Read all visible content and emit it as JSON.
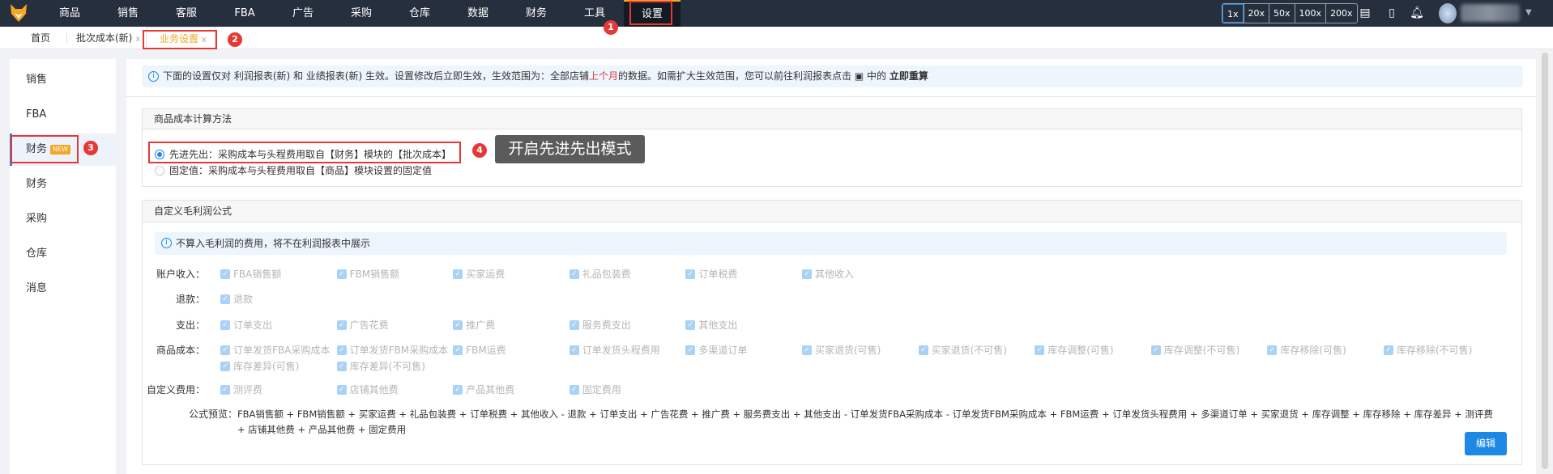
{
  "nav": {
    "items": [
      "商品",
      "销售",
      "客服",
      "FBA",
      "广告",
      "采购",
      "仓库",
      "数据",
      "财务",
      "工具",
      "设置"
    ],
    "active": "设置",
    "zoom_options": [
      "1x",
      "20x",
      "50x",
      "100x",
      "200x"
    ]
  },
  "tabs": {
    "home": "首页",
    "batch_cost": "批次成本(新)",
    "business_settings": "业务设置",
    "close": "x"
  },
  "annotations": {
    "b1": "1",
    "b2": "2",
    "b3": "3",
    "b4": "4",
    "tooltip": "开启先进先出模式"
  },
  "sidebar": {
    "items": [
      {
        "label": "销售"
      },
      {
        "label": "FBA"
      },
      {
        "label": "财务",
        "badge": "NEW"
      },
      {
        "label": "财务"
      },
      {
        "label": "采购"
      },
      {
        "label": "仓库"
      },
      {
        "label": "消息"
      }
    ]
  },
  "notice": {
    "pre": "下面的设置仅对 利润报表(新) 和 业绩报表(新) 生效。设置修改后立即生效，生效范围为：全部店铺",
    "highlight": "上个月",
    "post": "的数据。如需扩大生效范围，您可以前往利润报表点击 ▣ 中的 ",
    "link": "立即重算"
  },
  "cost_method": {
    "title": "商品成本计算方法",
    "options": [
      {
        "label": "先进先出：采购成本与头程费用取自【财务】模块的【批次成本】",
        "selected": true
      },
      {
        "label": "固定值：采购成本与头程费用取自【商品】模块设置的固定值",
        "selected": false
      }
    ]
  },
  "formula_card": {
    "title": "自定义毛利润公式",
    "info": "不算入毛利润的费用，将不在利润报表中展示",
    "rows": [
      {
        "label": "账户收入：",
        "items": [
          "FBA销售额",
          "FBM销售额",
          "买家运费",
          "礼品包装费",
          "订单税费",
          "其他收入"
        ]
      },
      {
        "label": "退款：",
        "items": [
          "退款"
        ]
      },
      {
        "label": "支出：",
        "items": [
          "订单支出",
          "广告花费",
          "推广费",
          "服务费支出",
          "其他支出"
        ]
      },
      {
        "label": "商品成本：",
        "items": [
          "订单发货FBA采购成本",
          "订单发货FBM采购成本",
          "FBM运费",
          "订单发货头程费用",
          "多渠道订单",
          "买家退货(可售)",
          "买家退货(不可售)",
          "库存调整(可售)",
          "库存调整(不可售)",
          "库存移除(可售)",
          "库存移除(不可售)",
          "库存差异(可售)",
          "库存差异(不可售)"
        ]
      },
      {
        "label": "自定义费用：",
        "items": [
          "测评费",
          "店铺其他费",
          "产品其他费",
          "固定费用"
        ]
      }
    ],
    "preview_label": "公式预览：",
    "preview": "FBA销售额 + FBM销售额 + 买家运费 + 礼品包装费 + 订单税费 + 其他收入 - 退款 + 订单支出 + 广告花费 + 推广费 + 服务费支出 + 其他支出 - 订单发货FBA采购成本 - 订单发货FBM采购成本 + FBM运费 + 订单发货头程费用 + 多渠道订单 + 买家退货 + 库存调整 + 库存移除 + 库存差异 + 测评费 + 店铺其他费 + 产品其他费 + 固定费用",
    "edit": "编辑"
  }
}
